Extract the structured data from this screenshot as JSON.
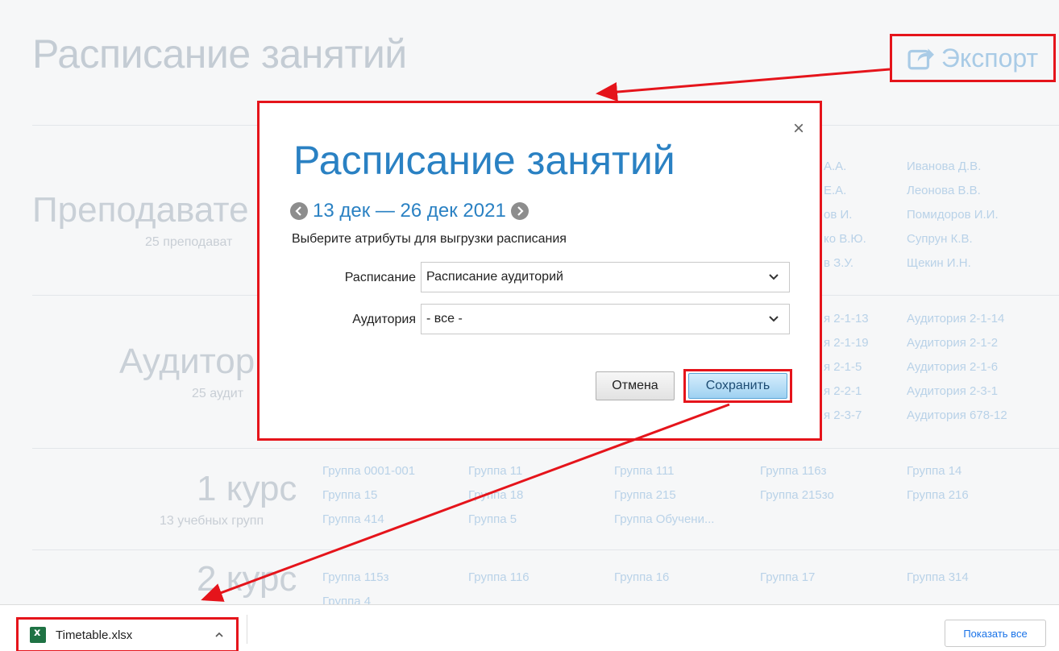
{
  "page": {
    "title": "Расписание занятий",
    "export_label": "Экспорт",
    "sections": {
      "teachers": {
        "title": "Преподавате",
        "subtitle": "25 преподават",
        "col_d": [
          "А.А.",
          "Е.А.",
          "ов И.",
          "ко В.Ю.",
          "в З.У."
        ],
        "col_e": [
          "Иванова Д.В.",
          "Леонова В.В.",
          "Помидоров И.И.",
          "Супрун К.В.",
          "Щекин И.Н."
        ]
      },
      "rooms": {
        "title": "Аудитор",
        "subtitle": "25 аудит",
        "col_d": [
          "я 2-1-13",
          "я 2-1-19",
          "я 2-1-5",
          "я 2-2-1",
          "я 2-3-7"
        ],
        "col_e": [
          "Аудитория 2-1-14",
          "Аудитория 2-1-2",
          "Аудитория 2-1-6",
          "Аудитория 2-3-1",
          "Аудитория 678-12"
        ]
      },
      "course1": {
        "title": "1 курс",
        "subtitle": "13 учебных групп",
        "col_a": [
          "Группа 0001-001",
          "Группа 15",
          "Группа 414"
        ],
        "col_b": [
          "Группа 11",
          "Группа 18",
          "Группа 5"
        ],
        "col_c": [
          "Группа 111",
          "Группа 215",
          "Группа Обучени..."
        ],
        "col_d": [
          "Группа 116з",
          "Группа 215зо"
        ],
        "col_e": [
          "Группа 14",
          "Группа 216"
        ]
      },
      "course2": {
        "title": "2 курс",
        "col_a": [
          "Группа 115з",
          "Группа 4"
        ],
        "col_b": [
          "Группа 116"
        ],
        "col_c": [
          "Группа 16"
        ],
        "col_d": [
          "Группа 17"
        ],
        "col_e": [
          "Группа 314"
        ]
      }
    }
  },
  "modal": {
    "title": "Расписание занятий",
    "close_glyph": "×",
    "date_range": "13 дек — 26 дек 2021",
    "hint": "Выберите атрибуты для выгрузки расписания",
    "fields": [
      {
        "label": "Расписание",
        "value": "Расписание аудиторий"
      },
      {
        "label": "Аудитория",
        "value": "- все -"
      }
    ],
    "cancel_label": "Отмена",
    "save_label": "Сохранить"
  },
  "downloads": {
    "file_name": "Timetable.xlsx",
    "show_all_label": "Показать все"
  },
  "colors": {
    "highlight": "#e5141b",
    "accent": "#2a81c3"
  }
}
